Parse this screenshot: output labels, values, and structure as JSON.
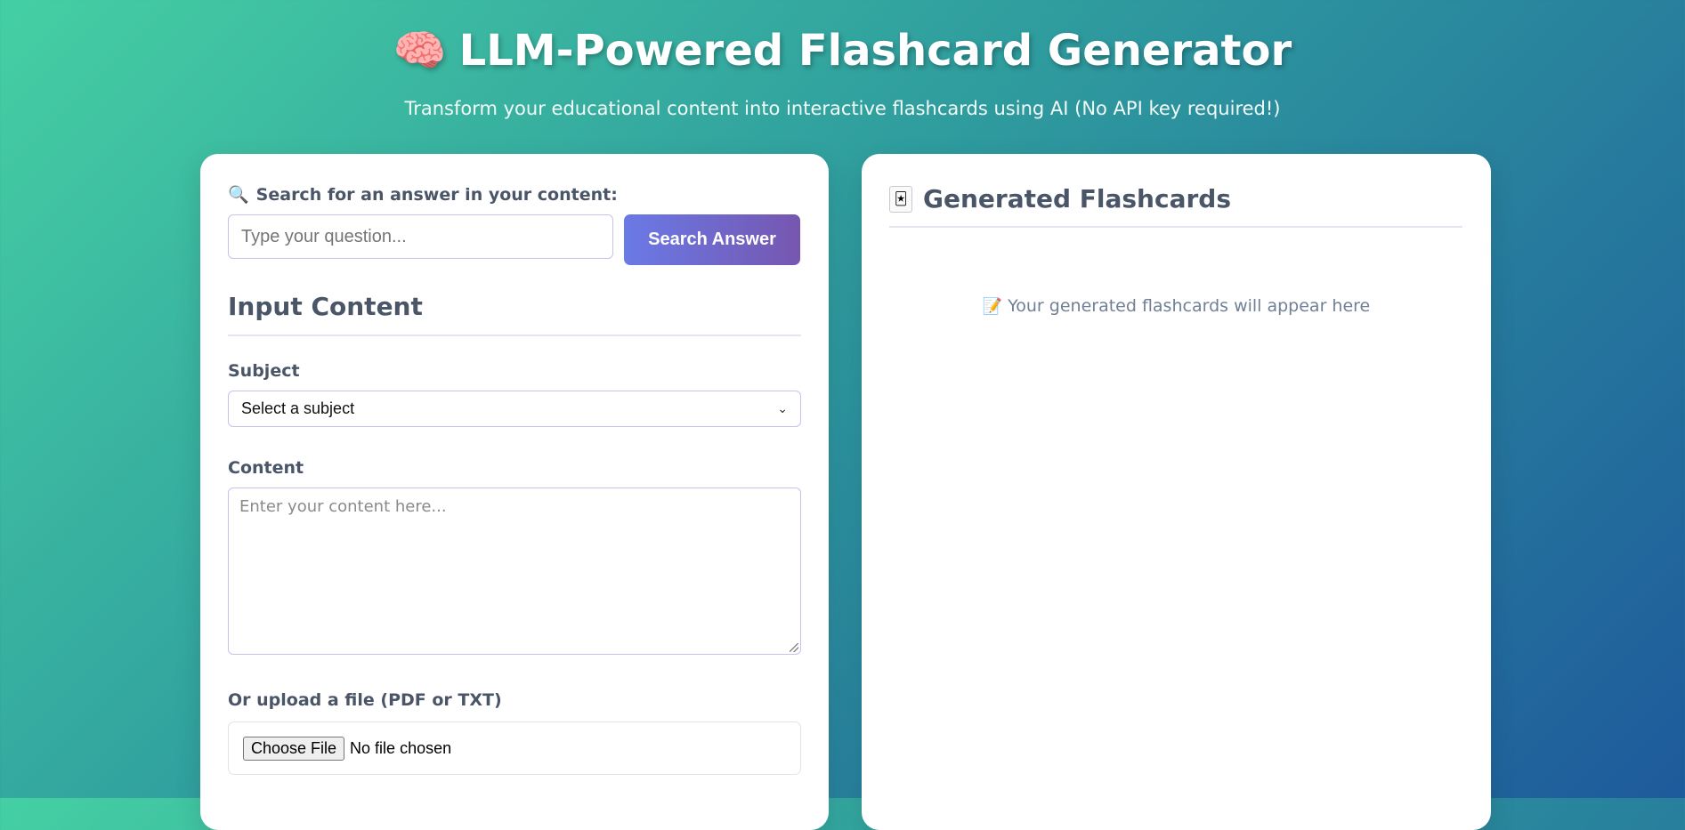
{
  "header": {
    "icon": "brain-icon",
    "icon_glyph": "🧠",
    "title": "LLM-Powered Flashcard Generator",
    "subtitle": "Transform your educational content into interactive flashcards using AI (No API key required!)"
  },
  "search": {
    "icon": "magnifier-icon",
    "icon_glyph": "🔍",
    "label": "Search for an answer in your content:",
    "placeholder": "Type your question...",
    "value": "",
    "button_label": "Search Answer"
  },
  "input_section": {
    "title": "Input Content",
    "subject_label": "Subject",
    "subject_selected": "Select a subject",
    "content_label": "Content",
    "content_placeholder": "Enter your content here...",
    "content_value": "",
    "upload_label": "Or upload a file (PDF or TXT)",
    "choose_file_label": "Choose File",
    "file_status": "No file chosen"
  },
  "flashcards": {
    "icon": "flashcards-icon",
    "icon_glyph": "🃏",
    "title": "Generated Flashcards",
    "empty_icon": "memo-icon",
    "empty_icon_glyph": "📝",
    "empty_text": "Your generated flashcards will appear here"
  },
  "colors": {
    "background_start": "#45cfa3",
    "background_end": "#1e5a9c",
    "button_start": "#6a7ae6",
    "button_end": "#7656b0",
    "heading_text": "#4a5568"
  }
}
